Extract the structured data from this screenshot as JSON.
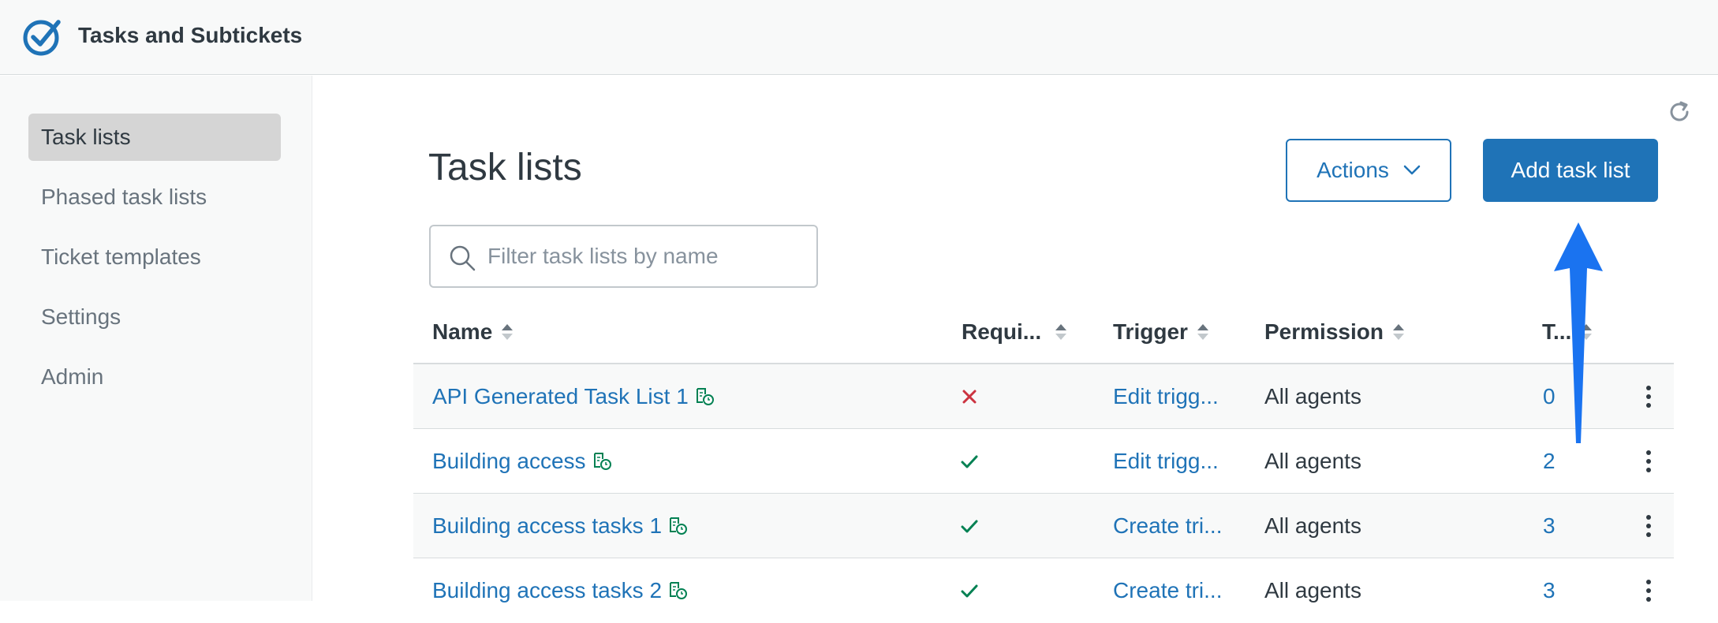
{
  "app": {
    "title": "Tasks and Subtickets"
  },
  "sidebar": {
    "items": [
      {
        "label": "Task lists",
        "active": true
      },
      {
        "label": "Phased task lists"
      },
      {
        "label": "Ticket templates"
      },
      {
        "label": "Settings"
      },
      {
        "label": "Admin"
      }
    ]
  },
  "main": {
    "title": "Task lists",
    "actions_label": "Actions",
    "add_label": "Add task list",
    "search": {
      "placeholder": "Filter task lists by name",
      "value": ""
    }
  },
  "table": {
    "columns": [
      "Name",
      "Requi...",
      "Trigger",
      "Permission",
      "T..."
    ],
    "rows": [
      {
        "name": "API Generated Task List 1",
        "required": false,
        "trigger": "Edit trigg...",
        "permission": "All agents",
        "count": "0"
      },
      {
        "name": "Building access",
        "required": true,
        "trigger": "Edit trigg...",
        "permission": "All agents",
        "count": "2"
      },
      {
        "name": "Building access tasks 1",
        "required": true,
        "trigger": "Create tri...",
        "permission": "All agents",
        "count": "3"
      },
      {
        "name": "Building access tasks 2",
        "required": true,
        "trigger": "Create tri...",
        "permission": "All agents",
        "count": "3"
      }
    ]
  },
  "colors": {
    "accent": "#1f73b7",
    "check": "#038153",
    "cross": "#cc3340",
    "annotation": "#1a73f0"
  }
}
